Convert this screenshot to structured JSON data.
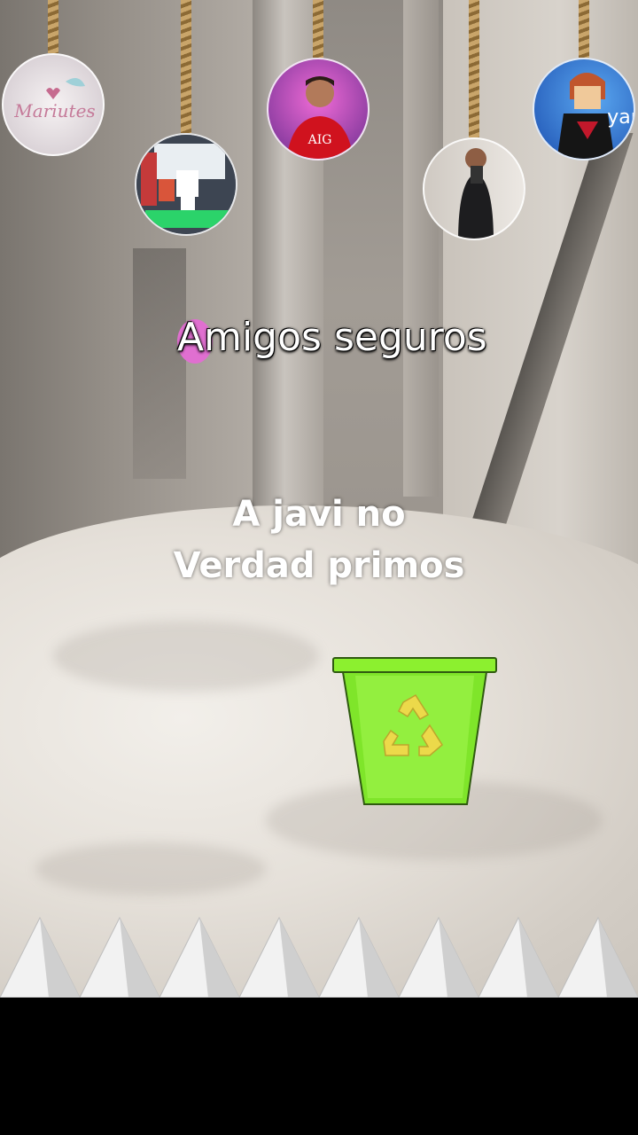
{
  "overlay": {
    "title": "Amigos seguros",
    "caption_line1": "A javi no",
    "caption_line2": "Verdad primos"
  },
  "avatars": [
    {
      "name": "avatar-1",
      "text": "Mariutes"
    },
    {
      "name": "avatar-2",
      "text": ""
    },
    {
      "name": "avatar-3",
      "text": "AIG"
    },
    {
      "name": "avatar-4",
      "text": ""
    },
    {
      "name": "avatar-5",
      "text": "yar"
    }
  ],
  "colors": {
    "bin_green": "#7fe52a",
    "bin_outline": "#2f5a10",
    "recycle_yellow": "#ecd94a",
    "title_pill": "#e06fd0"
  },
  "icons": {
    "bin": "recycle-bin-icon",
    "spikes": "spike-row-icon"
  }
}
